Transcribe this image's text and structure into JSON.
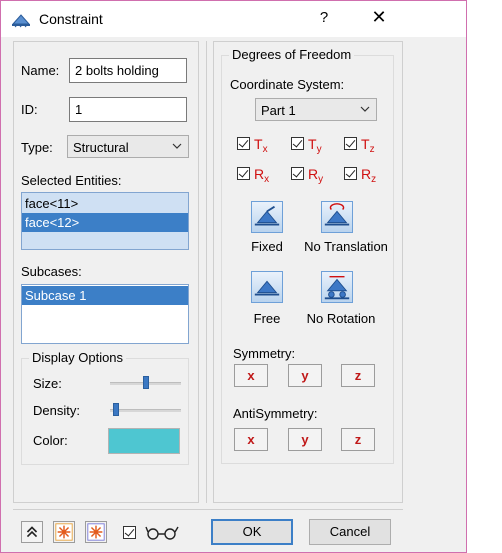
{
  "title": "Constraint",
  "title_help": "?",
  "title_close": "✕",
  "left": {
    "name_label": "Name:",
    "name_value": "2 bolts holding",
    "id_label": "ID:",
    "id_value": "1",
    "type_label": "Type:",
    "type_value": "Structural",
    "selected_entities_label": "Selected Entities:",
    "entities": [
      "face<11>",
      "face<12>"
    ],
    "subcases_label": "Subcases:",
    "subcases": [
      "Subcase 1"
    ],
    "display_options": {
      "title": "Display Options",
      "size_label": "Size:",
      "size_level": 0.5,
      "density_label": "Density:",
      "density_level": 0.05,
      "color_label": "Color:",
      "color_value": "#4ec6d1"
    }
  },
  "right": {
    "dof_title": "Degrees of Freedom",
    "coord_label": "Coordinate System:",
    "coord_value": "Part 1",
    "t_letter": "T",
    "r_letter": "R",
    "axes": [
      "x",
      "y",
      "z"
    ],
    "presets": [
      "Fixed",
      "No Translation",
      "Free",
      "No Rotation"
    ],
    "symmetry_label": "Symmetry:",
    "antisymmetry_label": "AntiSymmetry:",
    "sym_buttons": [
      "x",
      "y",
      "z"
    ]
  },
  "bottom": {
    "ok_label": "OK",
    "cancel_label": "Cancel"
  },
  "colors": {
    "accent": "#3c7fc7",
    "dof_red": "#d01010",
    "swatch": "#4ec6d1"
  }
}
